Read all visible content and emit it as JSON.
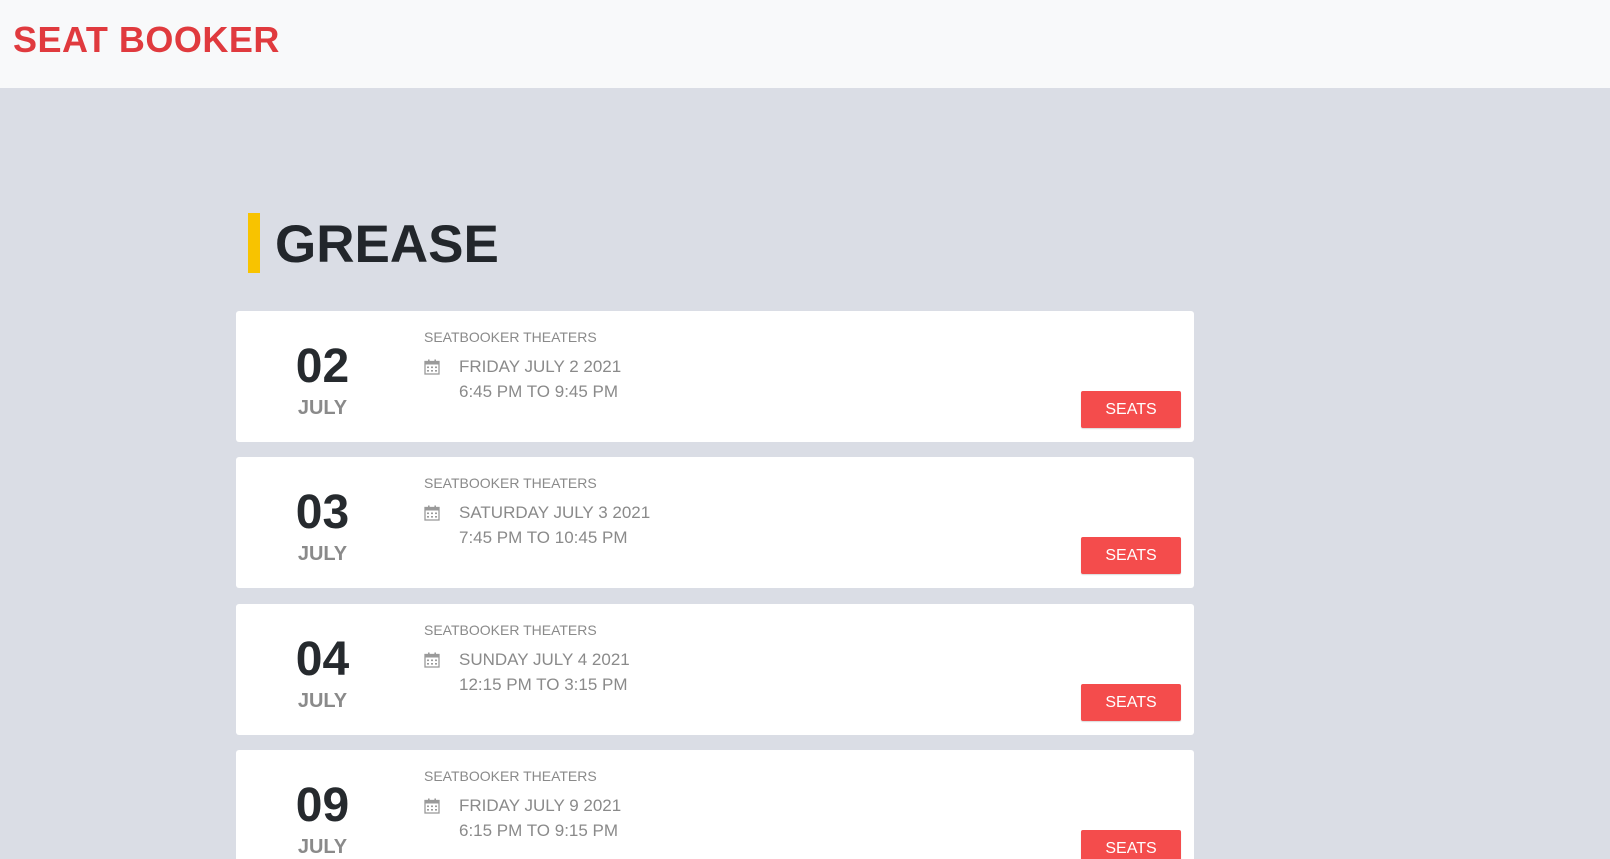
{
  "header": {
    "brand": "SEAT BOOKER"
  },
  "movie": {
    "title": "GREASE"
  },
  "showtimes": [
    {
      "day": "02",
      "month": "JULY",
      "venue": "SEATBOOKER THEATERS",
      "date": "FRIDAY JULY 2 2021",
      "time": "6:45 PM TO 9:45 PM",
      "button": "SEATS"
    },
    {
      "day": "03",
      "month": "JULY",
      "venue": "SEATBOOKER THEATERS",
      "date": "SATURDAY JULY 3 2021",
      "time": "7:45 PM TO 10:45 PM",
      "button": "SEATS"
    },
    {
      "day": "04",
      "month": "JULY",
      "venue": "SEATBOOKER THEATERS",
      "date": "SUNDAY JULY 4 2021",
      "time": "12:15 PM TO 3:15 PM",
      "button": "SEATS"
    },
    {
      "day": "09",
      "month": "JULY",
      "venue": "SEATBOOKER THEATERS",
      "date": "FRIDAY JULY 9 2021",
      "time": "6:15 PM TO 9:15 PM",
      "button": "SEATS"
    }
  ],
  "icons": {
    "calendar": "calendar-icon"
  },
  "colors": {
    "brand": "#e03a3e",
    "accent_bar": "#f8c300",
    "button": "#f44c4c",
    "background": "#dadde5"
  }
}
